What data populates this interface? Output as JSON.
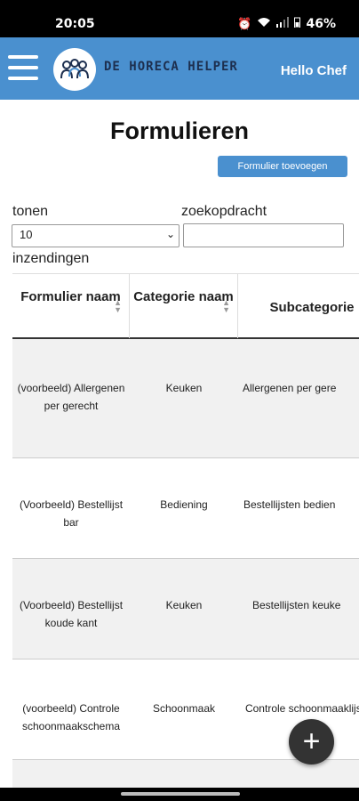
{
  "status": {
    "time": "20:05",
    "battery": "46%"
  },
  "app": {
    "brand": "DE HORECA HELPER",
    "greeting": "Hello Chef"
  },
  "page": {
    "title": "Formulieren",
    "add_button": "Formulier toevoegen"
  },
  "controls": {
    "show_label": "tonen",
    "show_value": "10",
    "entries_label": "inzendingen",
    "search_label": "zoekopdracht",
    "search_value": ""
  },
  "table": {
    "headers": [
      "Formulier naam",
      "Categorie naam",
      "Subcategorie"
    ],
    "rows": [
      {
        "name": "(voorbeeld) Allergenen per gerecht",
        "category": "Keuken",
        "subcategory": "Allergenen per gere"
      },
      {
        "name": "(Voorbeeld) Bestellijst bar",
        "category": "Bediening",
        "subcategory": "Bestellijsten bedien"
      },
      {
        "name": "(Voorbeeld) Bestellijst koude kant",
        "category": "Keuken",
        "subcategory": "Bestellijsten keuke"
      },
      {
        "name": "(voorbeeld) Controle schoonmaakschema",
        "category": "Schoonmaak",
        "subcategory": "Controle schoonmaaklijst"
      }
    ]
  },
  "fab": {
    "label": "+"
  }
}
